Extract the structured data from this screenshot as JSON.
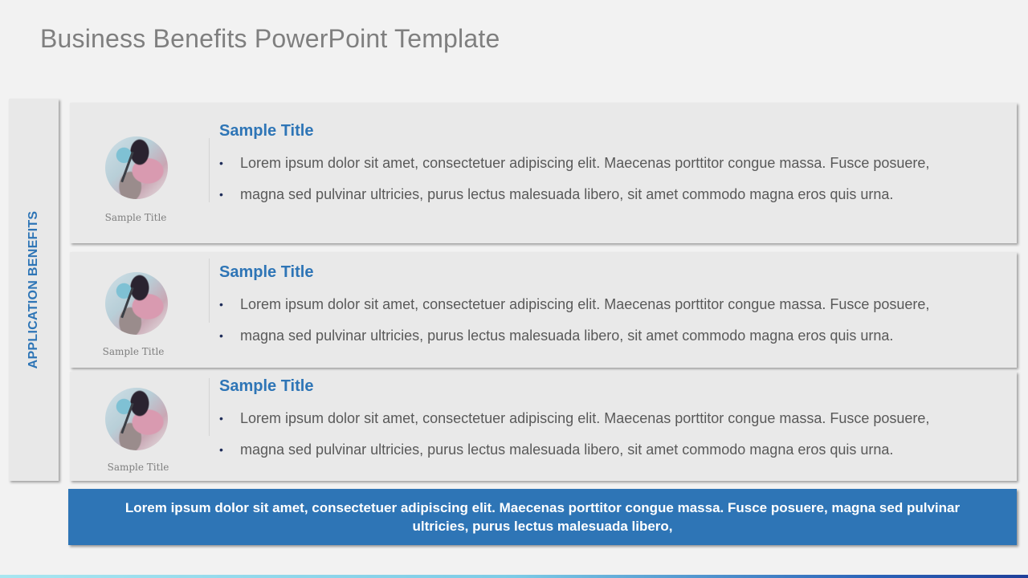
{
  "slide": {
    "title": "Business Benefits PowerPoint Template",
    "side_label": "APPLICATION BENEFITS",
    "cards": [
      {
        "image_caption": "Sample Title",
        "title": "Sample Title",
        "bullets": [
          "Lorem ipsum dolor sit amet, consectetuer adipiscing elit. Maecenas porttitor congue massa. Fusce posuere,",
          "magna sed pulvinar ultricies, purus lectus malesuada libero, sit amet commodo magna eros quis urna."
        ]
      },
      {
        "image_caption": "Sample Title",
        "title": "Sample Title",
        "bullets": [
          "Lorem ipsum dolor sit amet, consectetuer adipiscing elit. Maecenas porttitor congue massa. Fusce posuere,",
          "magna sed pulvinar ultricies, purus lectus malesuada libero, sit amet commodo magna eros quis urna."
        ]
      },
      {
        "image_caption": "Sample Title",
        "title": "Sample Title",
        "bullets": [
          "Lorem ipsum dolor sit amet, consectetuer adipiscing elit. Maecenas porttitor congue massa. Fusce posuere,",
          "magna sed pulvinar ultricies, purus lectus malesuada libero, sit amet commodo magna eros quis urna."
        ]
      }
    ],
    "banner_text": "Lorem ipsum dolor sit amet, consectetuer adipiscing elit. Maecenas porttitor congue massa. Fusce posuere, magna sed pulvinar ultricies, purus lectus malesuada libero,"
  },
  "colors": {
    "accent": "#2e75b6",
    "title_gray": "#7f7f7f",
    "card_bg": "#e9e9e9",
    "body_text": "#595959"
  }
}
